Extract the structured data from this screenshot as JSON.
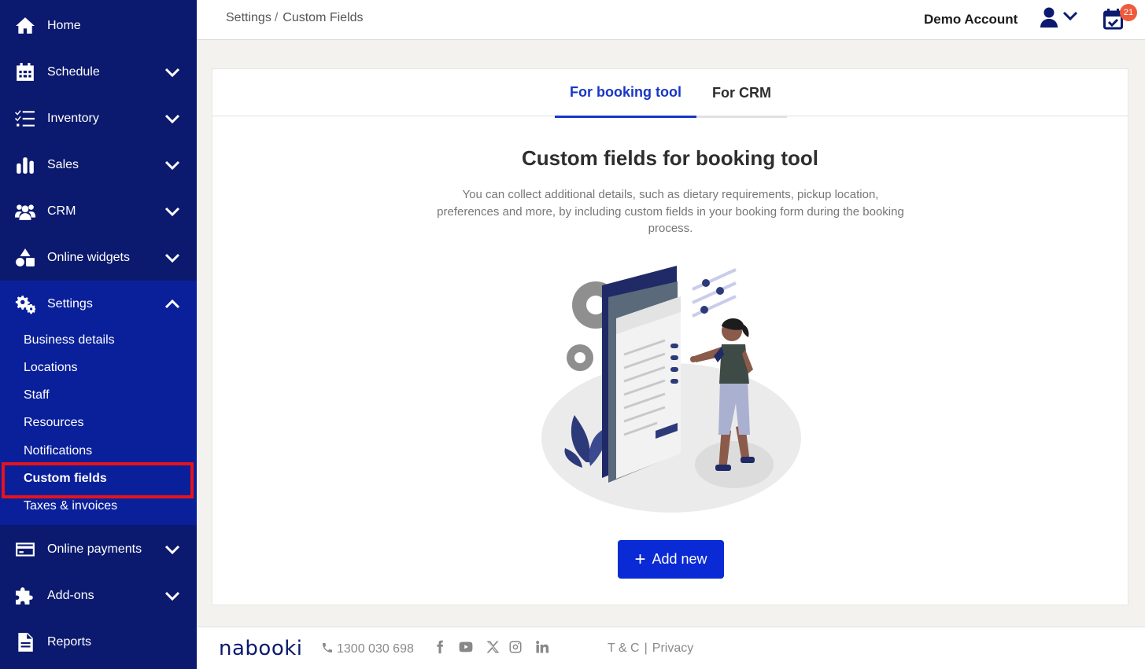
{
  "sidebar": {
    "items": [
      {
        "label": "Home",
        "icon": "home-icon"
      },
      {
        "label": "Schedule",
        "icon": "calendar-grid-icon"
      },
      {
        "label": "Inventory",
        "icon": "checklist-icon"
      },
      {
        "label": "Sales",
        "icon": "bar-chart-icon"
      },
      {
        "label": "CRM",
        "icon": "users-icon"
      },
      {
        "label": "Online widgets",
        "icon": "shapes-icon"
      },
      {
        "label": "Settings",
        "icon": "gears-icon"
      },
      {
        "label": "Online payments",
        "icon": "credit-card-icon"
      },
      {
        "label": "Add-ons",
        "icon": "puzzle-icon"
      },
      {
        "label": "Reports",
        "icon": "document-icon"
      }
    ],
    "settings_sub": [
      {
        "label": "Business details"
      },
      {
        "label": "Locations"
      },
      {
        "label": "Staff"
      },
      {
        "label": "Resources"
      },
      {
        "label": "Notifications"
      },
      {
        "label": "Custom fields"
      },
      {
        "label": "Taxes & invoices"
      }
    ]
  },
  "topbar": {
    "breadcrumb_parent": "Settings",
    "breadcrumb_separator": "/",
    "breadcrumb_current": "Custom Fields",
    "account_name": "Demo Account",
    "calendar_badge": "21"
  },
  "main": {
    "tabs": [
      {
        "label": "For booking tool"
      },
      {
        "label": "For CRM"
      }
    ],
    "title": "Custom fields for booking tool",
    "description": "You can collect additional details, such as dietary requirements, pickup location, preferences and more, by including custom fields in your booking form during the booking process.",
    "add_button": "Add new"
  },
  "footer": {
    "logo": "nabooki",
    "phone": "1300 030 698",
    "terms": "T & C",
    "separator": "|",
    "privacy": "Privacy"
  },
  "colors": {
    "sidebar_bg": "#0b1a6e",
    "settings_group_bg": "#0a209a",
    "accent": "#1836c6",
    "button": "#0a2ad6",
    "badge": "#ef5a3c",
    "highlight_border": "#e8121b"
  }
}
